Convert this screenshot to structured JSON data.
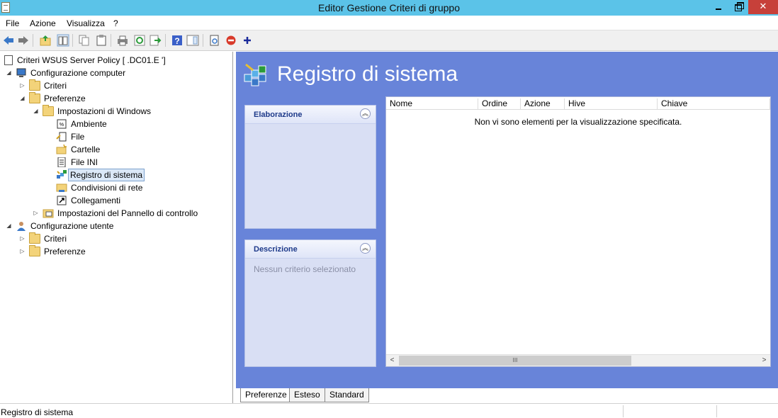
{
  "window": {
    "title": "Editor Gestione Criteri di gruppo",
    "controls": {
      "minimize": "",
      "maximize": "",
      "close": "✕"
    }
  },
  "menu": [
    "File",
    "Azione",
    "Visualizza",
    "?"
  ],
  "toolbar": {
    "icons": [
      "back-arrow-icon",
      "forward-arrow-icon",
      "up-folder-icon",
      "show-hide-tree-icon",
      "copy-icon",
      "paste-icon",
      "print-icon",
      "refresh-icon",
      "export-list-icon",
      "help-icon",
      "show-hide-action-pane-icon",
      "properties-icon",
      "stop-icon",
      "add-icon"
    ]
  },
  "tree": {
    "root": "Criteri WSUS Server Policy [        .DC01.E                         ']",
    "computer": "Configurazione computer",
    "computer_criteri": "Criteri",
    "computer_preferenze": "Preferenze",
    "windows_settings": "Impostazioni di Windows",
    "items": [
      "Ambiente",
      "File",
      "Cartelle",
      "File INI",
      "Registro di sistema",
      "Condivisioni di rete",
      "Collegamenti"
    ],
    "control_panel": "Impostazioni del Pannello di controllo",
    "user": "Configurazione utente",
    "user_criteri": "Criteri",
    "user_preferenze": "Preferenze"
  },
  "main": {
    "heading": "Registro di sistema",
    "processing_title": "Elaborazione",
    "description_title": "Descrizione",
    "description_text": "Nessun criterio selezionato",
    "columns": [
      "Nome",
      "Ordine",
      "Azione",
      "Hive",
      "Chiave"
    ],
    "empty_message": "Non vi sono elementi per la visualizzazione specificata.",
    "scroll_thumb": "III"
  },
  "tabs": [
    "Preferenze",
    "Esteso",
    "Standard"
  ],
  "status": "Registro di sistema",
  "colors": {
    "titlebar": "#5bc3e8",
    "pane": "#6884d9",
    "close": "#c7403a"
  }
}
